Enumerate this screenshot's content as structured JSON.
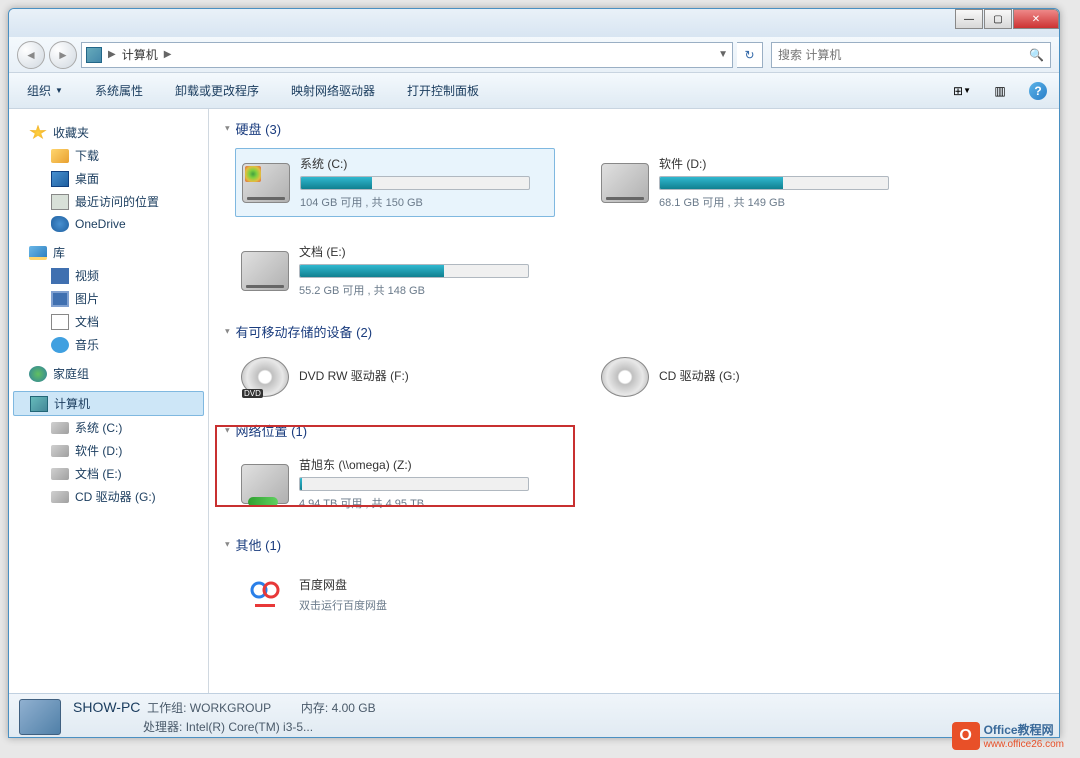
{
  "addressbar": {
    "location": "计算机"
  },
  "search": {
    "placeholder": "搜索 计算机"
  },
  "toolbar": {
    "organize": "组织",
    "properties": "系统属性",
    "uninstall": "卸载或更改程序",
    "mapdrive": "映射网络驱动器",
    "controlpanel": "打开控制面板"
  },
  "sidebar": {
    "favorites": "收藏夹",
    "downloads": "下载",
    "desktop": "桌面",
    "recent": "最近访问的位置",
    "onedrive": "OneDrive",
    "libraries": "库",
    "videos": "视频",
    "pictures": "图片",
    "documents": "文档",
    "music": "音乐",
    "homegroup": "家庭组",
    "computer": "计算机",
    "drive_c": "系统 (C:)",
    "drive_d": "软件 (D:)",
    "drive_e": "文档 (E:)",
    "drive_g": "CD 驱动器 (G:)"
  },
  "sections": {
    "hdd": "硬盘 (3)",
    "removable": "有可移动存储的设备 (2)",
    "network": "网络位置 (1)",
    "other": "其他 (1)"
  },
  "drives": {
    "c": {
      "name": "系统 (C:)",
      "capacity": "104 GB 可用 , 共 150 GB",
      "fill": 31
    },
    "d": {
      "name": "软件 (D:)",
      "capacity": "68.1 GB 可用 , 共 149 GB",
      "fill": 54
    },
    "e": {
      "name": "文档 (E:)",
      "capacity": "55.2 GB 可用 , 共 148 GB",
      "fill": 63
    },
    "f": {
      "name": "DVD RW 驱动器 (F:)"
    },
    "g": {
      "name": "CD 驱动器 (G:)"
    },
    "z": {
      "name": "苗旭东 (\\\\omega) (Z:)",
      "capacity": "4.94 TB 可用 , 共 4.95 TB",
      "fill": 1
    }
  },
  "other": {
    "baidu_name": "百度网盘",
    "baidu_sub": "双击运行百度网盘"
  },
  "status": {
    "pc_name": "SHOW-PC",
    "workgroup_label": "工作组:",
    "workgroup": "WORKGROUP",
    "memory_label": "内存:",
    "memory": "4.00 GB",
    "cpu_label": "处理器:",
    "cpu": "Intel(R) Core(TM) i3-5..."
  },
  "watermark": {
    "brand1": "Office",
    "brand2": "教程网",
    "url": "www.office26.com"
  }
}
